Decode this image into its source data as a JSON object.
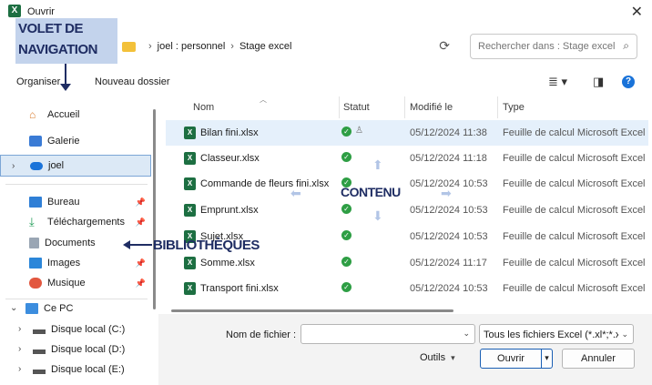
{
  "window": {
    "title": "Ouvrir",
    "app_icon": "X"
  },
  "breadcrumb": {
    "items": [
      "joel : personnel",
      "Stage excel"
    ]
  },
  "search": {
    "placeholder": "Rechercher dans : Stage excel"
  },
  "commandbar": {
    "organize": "Organiser",
    "new_folder": "Nouveau dossier",
    "organize_dropdown": "▾"
  },
  "nav": {
    "items": [
      {
        "label": "Accueil",
        "icon": "home-icon"
      },
      {
        "label": "Galerie",
        "icon": "gallery-icon"
      },
      {
        "label": "joel",
        "icon": "cloud-icon"
      },
      {
        "label": "Bureau",
        "icon": "desktop-icon"
      },
      {
        "label": "Téléchargements",
        "icon": "download-icon"
      },
      {
        "label": "Documents",
        "icon": "document-icon"
      },
      {
        "label": "Images",
        "icon": "pictures-icon"
      },
      {
        "label": "Musique",
        "icon": "music-icon"
      },
      {
        "label": "Ce PC",
        "icon": "pc-icon"
      },
      {
        "label": "Disque local (C:)",
        "icon": "drive-icon"
      },
      {
        "label": "Disque local (D:)",
        "icon": "drive-icon"
      },
      {
        "label": "Disque local (E:)",
        "icon": "drive-icon"
      }
    ]
  },
  "columns": {
    "name": "Nom",
    "status": "Statut",
    "modified": "Modifié le",
    "type": "Type"
  },
  "files": [
    {
      "name": "Bilan fini.xlsx",
      "date": "05/12/2024 11:38",
      "type": "Feuille de calcul Microsoft Excel"
    },
    {
      "name": "Classeur.xlsx",
      "date": "05/12/2024 11:18",
      "type": "Feuille de calcul Microsoft Excel"
    },
    {
      "name": "Commande de fleurs fini.xlsx",
      "date": "05/12/2024 10:53",
      "type": "Feuille de calcul Microsoft Excel"
    },
    {
      "name": "Emprunt.xlsx",
      "date": "05/12/2024 10:53",
      "type": "Feuille de calcul Microsoft Excel"
    },
    {
      "name": "Sujet.xlsx",
      "date": "05/12/2024 10:53",
      "type": "Feuille de calcul Microsoft Excel"
    },
    {
      "name": "Somme.xlsx",
      "date": "05/12/2024 11:17",
      "type": "Feuille de calcul Microsoft Excel"
    },
    {
      "name": "Transport fini.xlsx",
      "date": "05/12/2024 10:53",
      "type": "Feuille de calcul Microsoft Excel"
    }
  ],
  "footer": {
    "filename_label": "Nom de fichier :",
    "filename_value": "",
    "filter_value": "Tous les fichiers Excel (*.xl*;*.xlsx",
    "tools": "Outils",
    "open": "Ouvrir",
    "cancel": "Annuler"
  },
  "annotations": {
    "nav_line1": "VOLET DE",
    "nav_line2": "NAVIGATION",
    "content": "CONTENU",
    "libraries": "BIBLIOTHÈQUES"
  },
  "colors": {
    "accent": "#1a5fb4",
    "excel": "#1d6f42",
    "annotation": "#1f2d63",
    "annotation_bg": "#b9cbe9",
    "selected_row": "#e5f0fb"
  }
}
